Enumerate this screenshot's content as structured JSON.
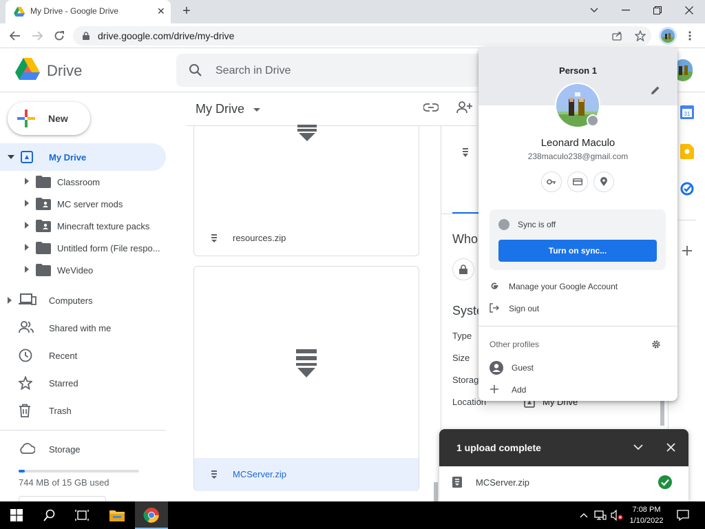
{
  "browser": {
    "tab_title": "My Drive - Google Drive",
    "url": "drive.google.com/drive/my-drive"
  },
  "drive": {
    "app_name": "Drive",
    "search_placeholder": "Search in Drive",
    "new_label": "New",
    "main_title": "My Drive"
  },
  "sidebar": {
    "my_drive": "My Drive",
    "folders": [
      {
        "label": "Classroom",
        "shared": false
      },
      {
        "label": "MC server mods",
        "shared": true
      },
      {
        "label": "Minecraft texture packs",
        "shared": true
      },
      {
        "label": "Untitled form (File respo...",
        "shared": false
      },
      {
        "label": "WeVideo",
        "shared": false
      }
    ],
    "computers": "Computers",
    "shared_with_me": "Shared with me",
    "recent": "Recent",
    "starred": "Starred",
    "trash": "Trash",
    "storage": "Storage",
    "storage_used": "744 MB of 15 GB used",
    "storage_fraction": 0.05
  },
  "files": [
    {
      "name": "resources.zip",
      "selected": false
    },
    {
      "name": "MCServer.zip",
      "selected": true
    }
  ],
  "details": {
    "who_heading": "Who",
    "system_heading": "Syste",
    "type_label": "Type",
    "size_label": "Size",
    "storage_label": "Storag",
    "location_label": "Location",
    "location_value": "My Drive"
  },
  "profile": {
    "person_label": "Person 1",
    "user_name": "Leonard Maculo",
    "user_email": "238maculo238@gmail.com",
    "sync_status": "Sync is off",
    "sync_button": "Turn on sync...",
    "manage_account": "Manage your Google Account",
    "sign_out": "Sign out",
    "other_profiles": "Other profiles",
    "guest": "Guest",
    "add": "Add"
  },
  "upload": {
    "title": "1 upload complete",
    "file_name": "MCServer.zip"
  },
  "taskbar": {
    "time": "7:08 PM",
    "date": "1/10/2022"
  },
  "colors": {
    "accent_blue": "#1a73e8",
    "selected_bg": "#e8f0fe",
    "success_green": "#1e8e3e"
  }
}
